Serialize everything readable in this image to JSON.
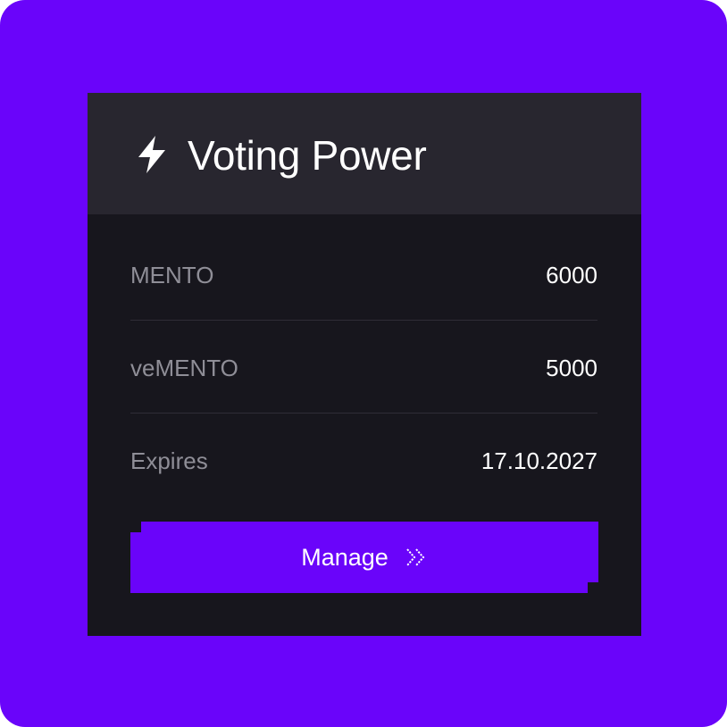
{
  "card": {
    "title": "Voting Power",
    "title_icon": "lightning-bolt-icon"
  },
  "rows": [
    {
      "label": "MENTO",
      "value": "6000"
    },
    {
      "label": "veMENTO",
      "value": "5000"
    },
    {
      "label": "Expires",
      "value": "17.10.2027"
    }
  ],
  "manage_button": {
    "label": "Manage",
    "icon": "double-chevron-right-icon"
  },
  "colors": {
    "background": "#6a04fa",
    "card_body": "#17161d",
    "card_header": "#28262f",
    "accent": "#6a04fa",
    "label_text": "#8f8e97",
    "value_text": "#ffffff"
  }
}
